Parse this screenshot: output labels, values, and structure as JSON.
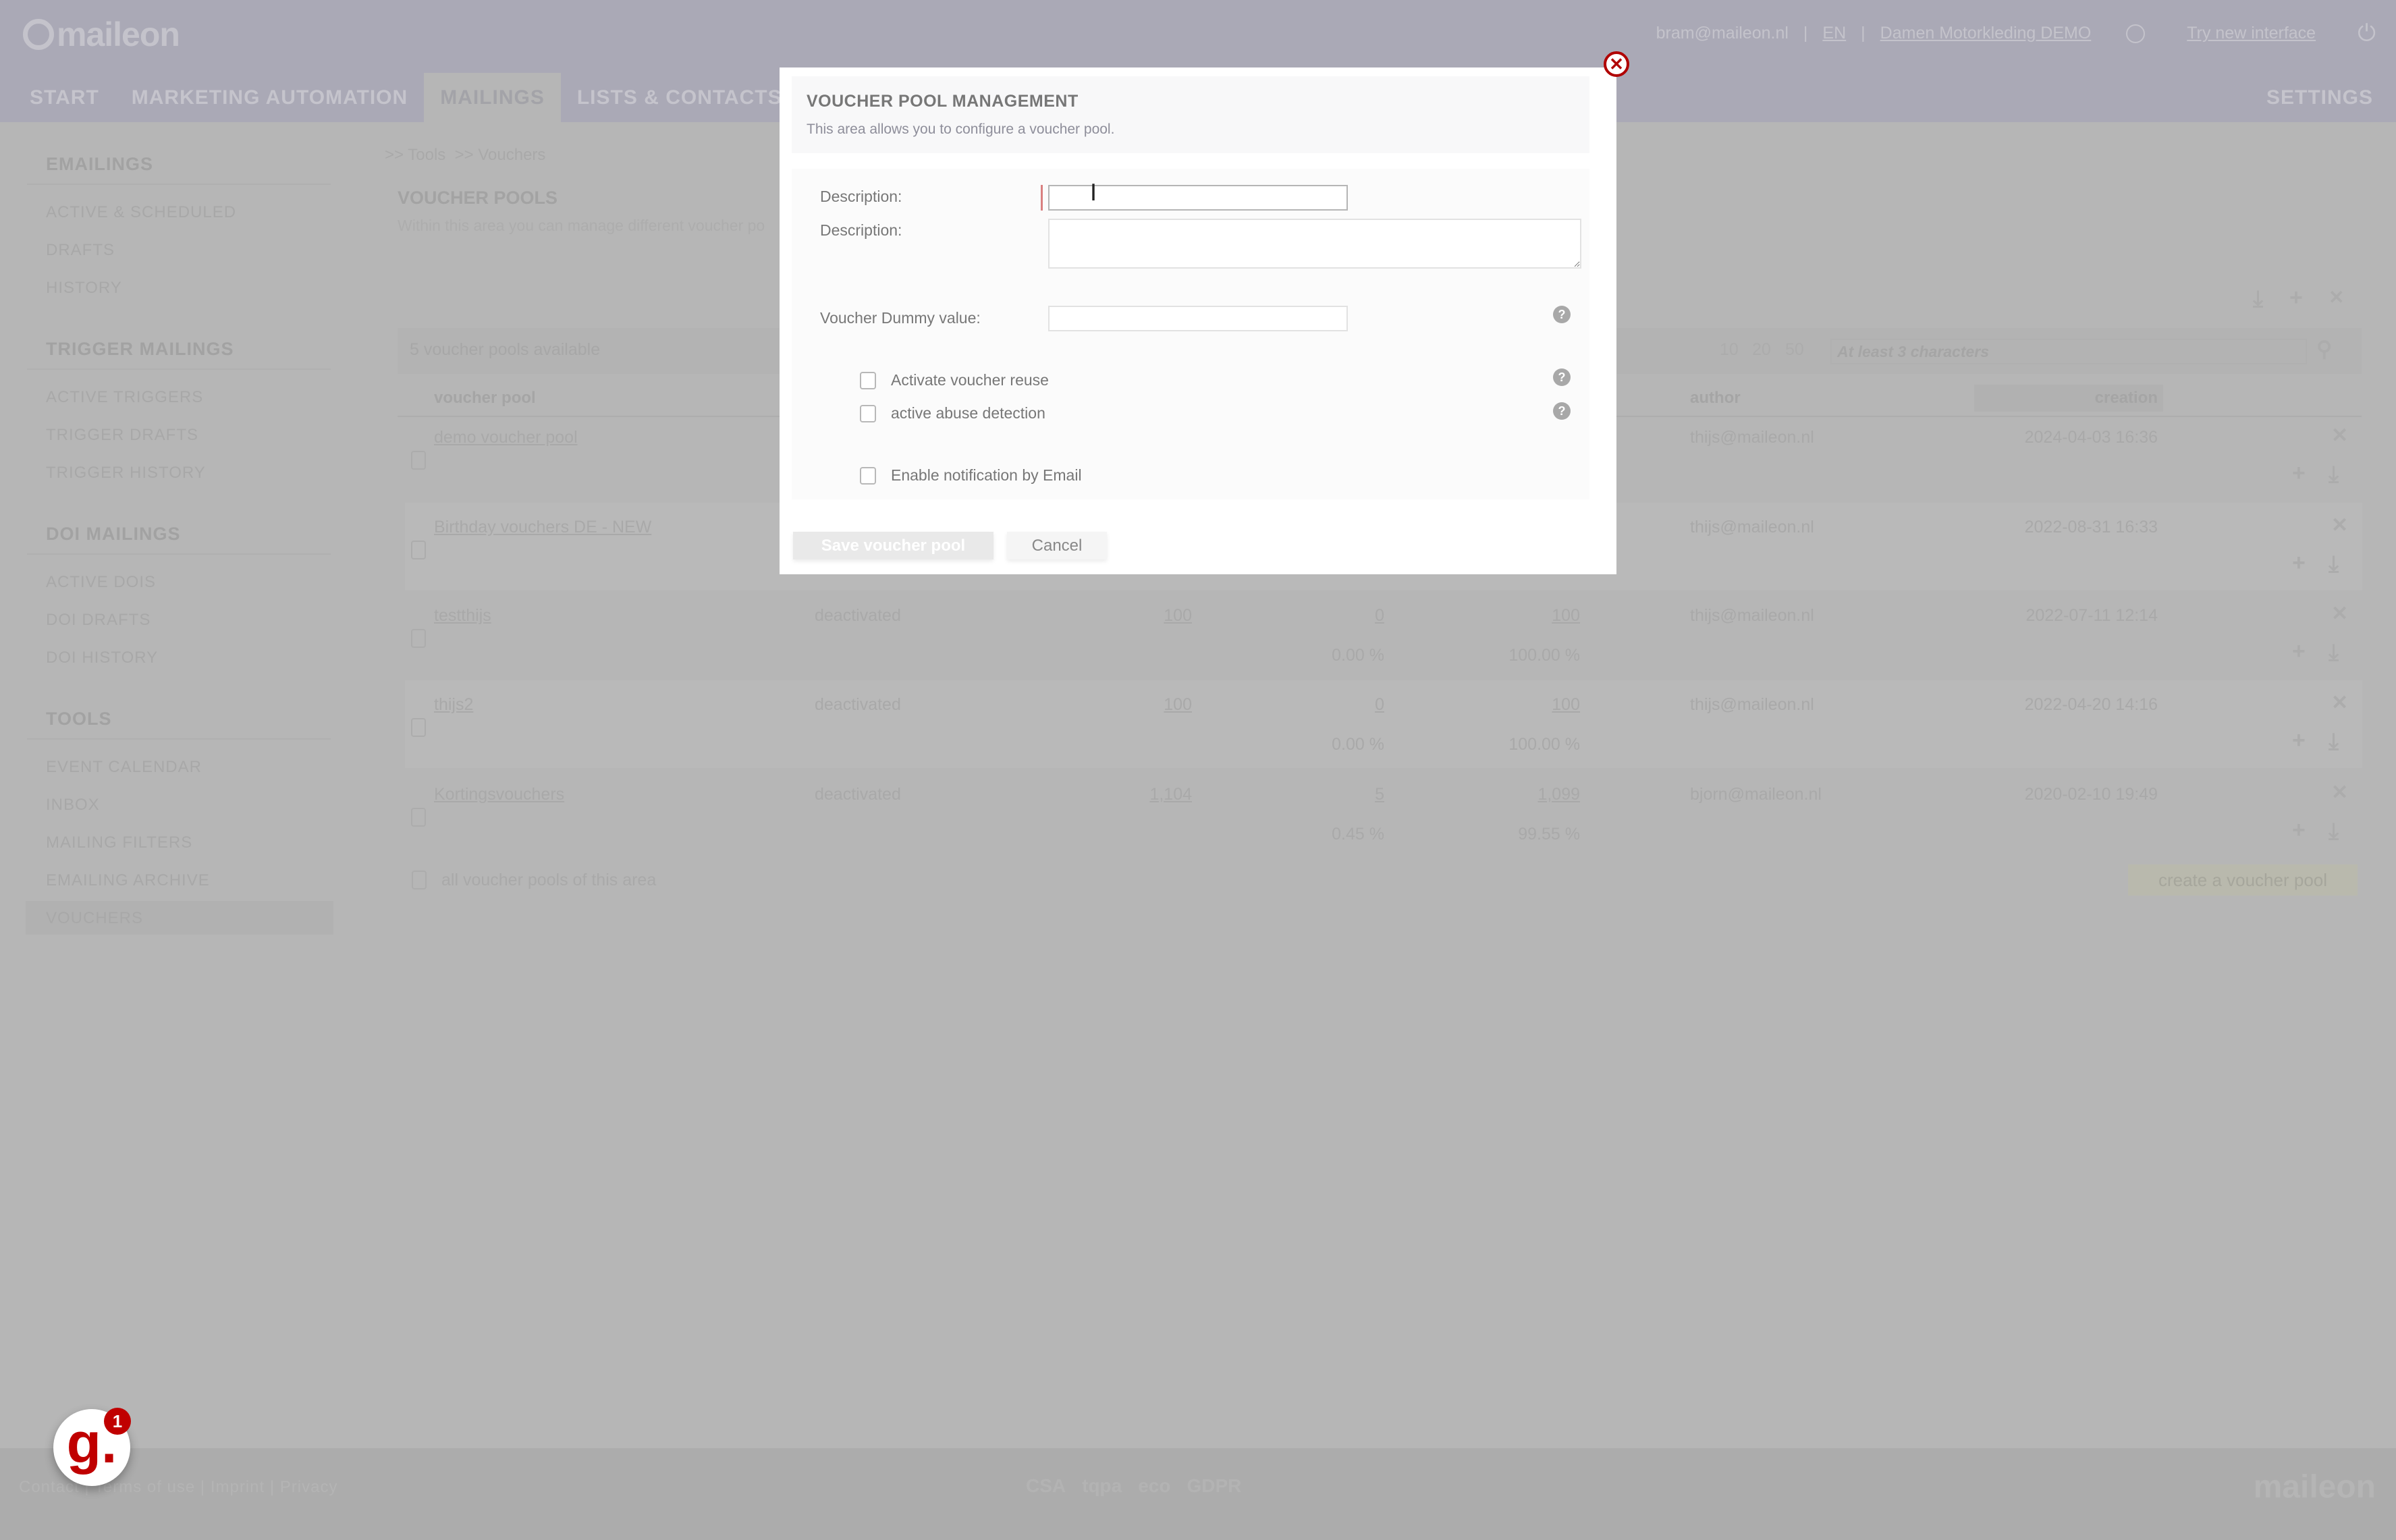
{
  "app": {
    "logo": "maileon"
  },
  "header": {
    "user": "bram@maileon.nl",
    "language": "EN",
    "account": "Damen Motorkleding DEMO",
    "try_new": "Try new interface",
    "nav": [
      "START",
      "MARKETING AUTOMATION",
      "MAILINGS",
      "LISTS & CONTACTS"
    ],
    "active_nav": "MAILINGS",
    "settings": "SETTINGS"
  },
  "sidebar": {
    "sections": [
      {
        "title": "EMAILINGS",
        "items": [
          "ACTIVE & SCHEDULED",
          "DRAFTS",
          "HISTORY"
        ]
      },
      {
        "title": "TRIGGER MAILINGS",
        "items": [
          "ACTIVE TRIGGERS",
          "TRIGGER DRAFTS",
          "TRIGGER HISTORY"
        ]
      },
      {
        "title": "DOI MAILINGS",
        "items": [
          "ACTIVE DOIS",
          "DOI DRAFTS",
          "DOI HISTORY"
        ]
      },
      {
        "title": "TOOLS",
        "items": [
          "EVENT CALENDAR",
          "INBOX",
          "MAILING FILTERS",
          "EMAILING ARCHIVE",
          "VOUCHERS"
        ]
      }
    ],
    "active_item": "VOUCHERS"
  },
  "main": {
    "breadcrumb": [
      ">> Tools",
      ">> Vouchers"
    ],
    "title": "VOUCHER POOLS",
    "subtitle": "Within this area you can manage different voucher po",
    "count": "5 voucher pools available",
    "page_sizes": [
      "10",
      "20",
      "50"
    ],
    "search_placeholder": "At least 3 characters",
    "columns": {
      "name": "voucher pool",
      "author": "author",
      "creation": "creation"
    },
    "rows": [
      {
        "name": "demo voucher pool",
        "status": "",
        "total": "",
        "used": "",
        "remaining": "",
        "used_pct": "",
        "remaining_pct": "",
        "author": "thijs@maileon.nl",
        "creation": "2024-04-03 16:36"
      },
      {
        "name": "Birthday vouchers DE - NEW",
        "status": "",
        "total": "",
        "used": "",
        "remaining": "",
        "used_pct": "",
        "remaining_pct": "",
        "author": "thijs@maileon.nl",
        "creation": "2022-08-31 16:33"
      },
      {
        "name": "testthijs",
        "status": "deactivated",
        "total": "100",
        "used": "0",
        "remaining": "100",
        "used_pct": "0.00 %",
        "remaining_pct": "100.00 %",
        "author": "thijs@maileon.nl",
        "creation": "2022-07-11 12:14"
      },
      {
        "name": "thijs2",
        "status": "deactivated",
        "total": "100",
        "used": "0",
        "remaining": "100",
        "used_pct": "0.00 %",
        "remaining_pct": "100.00 %",
        "author": "thijs@maileon.nl",
        "creation": "2022-04-20 14:16"
      },
      {
        "name": "Kortingsvouchers",
        "status": "deactivated",
        "total": "1,104",
        "used": "5",
        "remaining": "1,099",
        "used_pct": "0.45 %",
        "remaining_pct": "99.55 %",
        "author": "bjorn@maileon.nl",
        "creation": "2020-02-10 19:49"
      }
    ],
    "select_all": "all voucher pools of this area",
    "create_button": "create a voucher pool"
  },
  "footer": {
    "links": [
      "Contact",
      "Terms of use",
      "Imprint",
      "Privacy"
    ],
    "certs": [
      "CSA",
      "tqpa",
      "eco",
      "GDPR"
    ],
    "logo": "maileon"
  },
  "widget": {
    "letter": "g.",
    "badge": "1"
  },
  "modal": {
    "title": "VOUCHER POOL MANAGEMENT",
    "subtitle": "This area allows you to configure a voucher pool.",
    "fields": {
      "name_label": "Description:",
      "name_value": "",
      "description_label": "Description:",
      "description_value": "",
      "dummy_label": "Voucher Dummy value:",
      "dummy_value": ""
    },
    "checkboxes": [
      {
        "label": "Activate voucher reuse",
        "checked": false
      },
      {
        "label": "active abuse detection",
        "checked": false
      },
      {
        "label": "Enable notification by Email",
        "checked": false
      }
    ],
    "save_button": "Save voucher pool",
    "cancel_button": "Cancel",
    "help_symbol": "?",
    "close_symbol": "✕"
  },
  "colors": {
    "accent_red": "#c00000",
    "close_red": "#b00000"
  }
}
